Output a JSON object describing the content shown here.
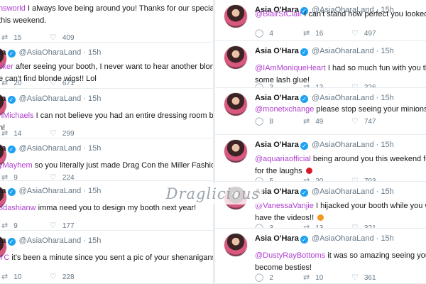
{
  "common": {
    "name": "Asia O'Hara",
    "handle": "@AsiaOharaLand",
    "dot": "·",
    "time": "15h",
    "verified_glyph": "✓",
    "caret_glyph": "⌄",
    "reply_icon": "reply-icon",
    "retweet_icon": "retweet-icon",
    "like_icon": "heart-icon"
  },
  "left": [
    {
      "lines": [
        [
          {
            "m": "nsworld"
          },
          {
            "t": " I always love being around you!  Thanks for our special"
          }
        ],
        [
          {
            "t": "this weekend."
          }
        ]
      ],
      "retweets": "15",
      "likes": "409"
    },
    {
      "lines": [
        [
          {
            "m": "cker"
          },
          {
            "t": " after seeing your booth, I never want to hear another blonde girl"
          }
        ],
        [
          {
            "t": "e can't find blonde wigs!!  Lol"
          }
        ]
      ],
      "retweets": "20",
      "likes": "671"
    },
    {
      "lines": [
        [
          {
            "m": "nMichaels"
          },
          {
            "t": " I can not believe you had an entire dressing room built in"
          }
        ],
        [
          {
            "t": "h!"
          }
        ]
      ],
      "retweets": "14",
      "likes": "299"
    },
    {
      "lines": [
        [
          {
            "m": "yMayhem"
          },
          {
            "t": " so you literally just made Drag Con the Miller Fashion Show!"
          }
        ]
      ],
      "retweets": "9",
      "likes": "224"
    },
    {
      "lines": [
        [
          {
            "m": "3dashianw"
          },
          {
            "t": " imma need you to design my booth next year!"
          }
        ]
      ],
      "retweets": "9",
      "likes": "177"
    },
    {
      "lines": [
        [
          {
            "m": "YC"
          },
          {
            "t": " it's been a minute since you sent a pic of your shenanigans!!!!"
          }
        ]
      ],
      "retweets": "10",
      "likes": "228"
    }
  ],
  "right": [
    {
      "lines": [
        [
          {
            "m": "@BlairStClair"
          },
          {
            "t": " I can't stand how perfect you looked this weeke"
          }
        ]
      ],
      "replies": "4",
      "retweets": "16",
      "likes": "497"
    },
    {
      "lines": [
        [
          {
            "m": "@IAmMoniqueHeart"
          },
          {
            "t": " I had so much fun with you this weeken"
          }
        ],
        [
          {
            "t": "some lash glue!"
          }
        ]
      ],
      "replies": "3",
      "retweets": "13",
      "likes": "326"
    },
    {
      "lines": [
        [
          {
            "m": "@monetxchange"
          },
          {
            "t": " please stop seeing your minions to my boo"
          }
        ]
      ],
      "replies": "8",
      "retweets": "49",
      "likes": "747"
    },
    {
      "lines": [
        [
          {
            "m": "@aquariaofficial"
          },
          {
            "t": " being around you this weekend felt like old t"
          }
        ],
        [
          {
            "t": "for the laughs "
          },
          {
            "e": "heart"
          }
        ]
      ],
      "replies": "5",
      "retweets": "20",
      "likes": "703"
    },
    {
      "lines": [
        [
          {
            "m": "@VanessaVanjie"
          },
          {
            "t": " I hijacked your booth while you were in the b"
          }
        ],
        [
          {
            "t": "have the videos!! "
          },
          {
            "e": "orange-heart"
          }
        ]
      ],
      "replies": "3",
      "retweets": "13",
      "likes": "321"
    },
    {
      "lines": [
        [
          {
            "m": "@DustyRayBottoms"
          },
          {
            "t": " it was so amazing seeing you.  I think o"
          }
        ],
        [
          {
            "t": "become besties!"
          }
        ]
      ],
      "replies": "2",
      "retweets": "10",
      "likes": "361"
    }
  ],
  "watermark": "Draglicious",
  "colors": {
    "mention": "#b040cf",
    "muted": "#657786",
    "verified": "#1da1f2",
    "divider": "#e6ecf0"
  }
}
